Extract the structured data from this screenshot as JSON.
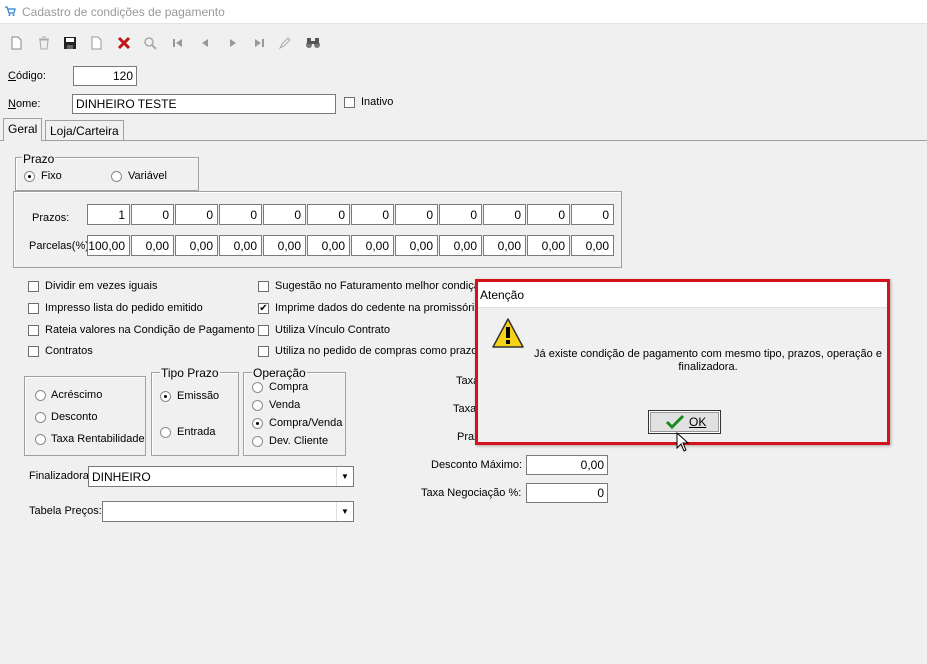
{
  "window": {
    "title": "Cadastro de condições de pagamento"
  },
  "toolbar": {
    "icons": [
      "new-icon",
      "delete-icon",
      "save-icon",
      "copy-icon",
      "cancel-icon",
      "search-icon",
      "first-icon",
      "prev-icon",
      "next-icon",
      "last-icon",
      "edit-icon",
      "binoculars-icon"
    ]
  },
  "form": {
    "codigo_label": "Código:",
    "codigo_value": "120",
    "nome_label": "Nome:",
    "nome_value": "DINHEIRO TESTE",
    "inativo_label": "Inativo"
  },
  "tabs": [
    {
      "label": "Geral"
    },
    {
      "label": "Loja/Carteira"
    }
  ],
  "prazo": {
    "legend": "Prazo",
    "fixo": "Fixo",
    "variavel": "Variável"
  },
  "grid": {
    "prazos_label": "Prazos:",
    "parcelas_label": "Parcelas(%):",
    "prazos": [
      "1",
      "0",
      "0",
      "0",
      "0",
      "0",
      "0",
      "0",
      "0",
      "0",
      "0",
      "0"
    ],
    "parcelas": [
      "100,00",
      "0,00",
      "0,00",
      "0,00",
      "0,00",
      "0,00",
      "0,00",
      "0,00",
      "0,00",
      "0,00",
      "0,00",
      "0,00"
    ]
  },
  "checks_left": [
    {
      "label": "Dividir em vezes iguais",
      "checked": false
    },
    {
      "label": "Impresso lista do pedido emitido",
      "checked": false
    },
    {
      "label": "Rateia valores na Condição de Pagamento",
      "checked": false
    },
    {
      "label": "Contratos",
      "checked": false
    }
  ],
  "checks_right": [
    {
      "label": "Sugestão no Faturamento melhor condição",
      "checked": false
    },
    {
      "label": "Imprime dados do cedente na promissória",
      "checked": true
    },
    {
      "label": "Utiliza Vínculo Contrato",
      "checked": false
    },
    {
      "label": "Utiliza no pedido de compras como prazo v",
      "checked": false
    }
  ],
  "tipo": {
    "acrescimo": "Acréscimo",
    "desconto": "Desconto",
    "taxa": "Taxa Rentabilidade"
  },
  "tipo_prazo": {
    "legend": "Tipo Prazo",
    "emissao": "Emissão",
    "entrada": "Entrada"
  },
  "operacao": {
    "legend": "Operação",
    "compra": "Compra",
    "venda": "Venda",
    "compra_venda": "Compra/Venda",
    "dev_cliente": "Dev. Cliente"
  },
  "finalizadora": {
    "label": "Finalizadora:",
    "value": "DINHEIRO"
  },
  "tabela_precos": {
    "label": "Tabela Preços:",
    "value": ""
  },
  "right_fields": {
    "taxa1": "Taxa",
    "taxa2": "Taxa",
    "prazo": "Praz",
    "desconto_label": "Desconto Máximo:",
    "desconto_value": "0,00",
    "negociacao_label": "Taxa Negociação %:",
    "negociacao_value": "0"
  },
  "dialog": {
    "title": "Atenção",
    "message": "Já existe condição de pagamento com mesmo tipo, prazos, operação e finalizadora.",
    "ok_label": "OK",
    "border_color": "#d4121b"
  }
}
